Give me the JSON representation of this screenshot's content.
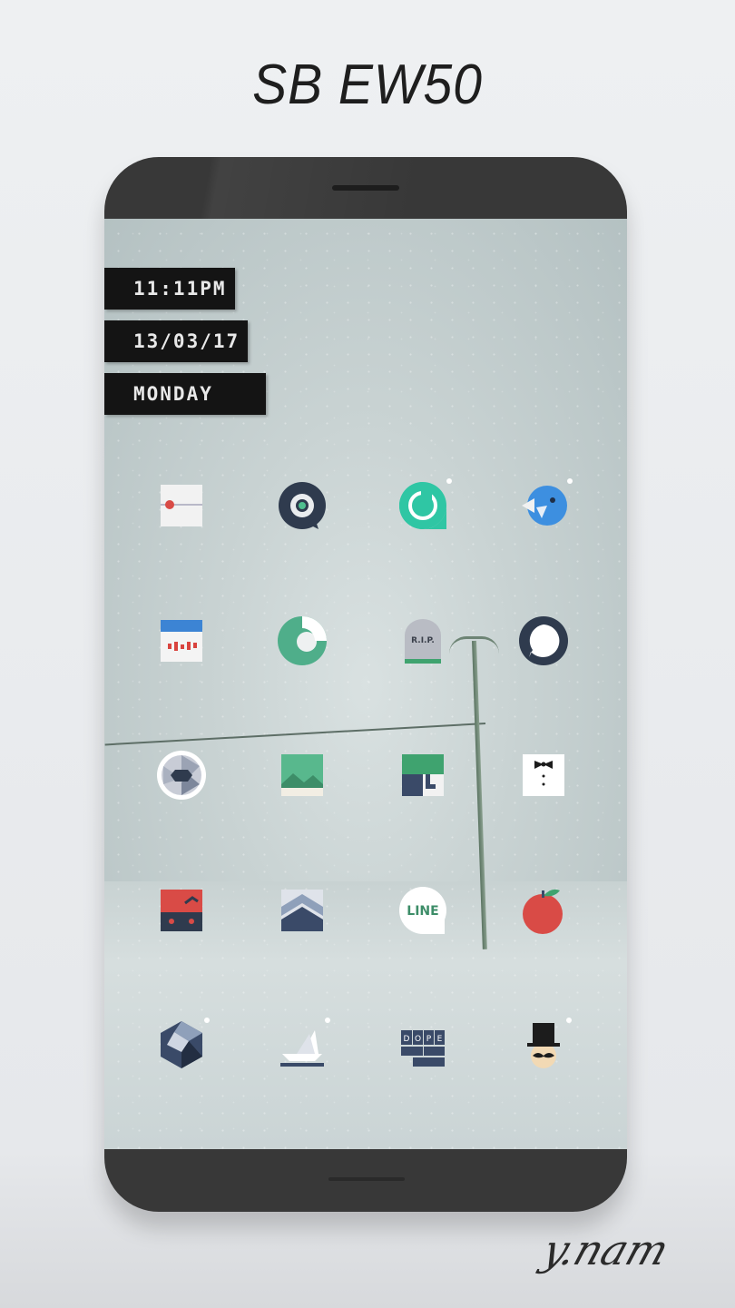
{
  "header": {
    "title": "SB EW50"
  },
  "widgets": {
    "time": "11:11PM",
    "date": "13/03/17",
    "day": "MONDAY"
  },
  "colors": {
    "background": "#eef0f2",
    "phone_body": "#383838",
    "widget_bg": "#141414",
    "widget_text": "#e8e8e8"
  },
  "home_grid": {
    "rows": [
      [
        "slider-app-icon",
        "chat-bubble-app-icon",
        "refresh-bubble-app-icon",
        "blue-bird-app-icon"
      ],
      [
        "calendar-chart-app-icon",
        "green-circle-app-icon",
        "rip-tombstone-app-icon",
        "message-bubble-app-icon"
      ],
      [
        "camera-aperture-app-icon",
        "landscape-photo-app-icon",
        "green-box-app-icon",
        "tuxedo-bowtie-app-icon"
      ],
      [
        "red-robot-app-icon",
        "chevron-stack-app-icon",
        "line-app-icon",
        "red-apple-app-icon"
      ],
      [
        "hexagon-gem-app-icon",
        "paper-boat-app-icon",
        "dope-app-icon",
        "top-hat-mustache-app-icon"
      ]
    ],
    "rip_label": "R.I.P.",
    "line_label": "LINE",
    "dope_letters": [
      "D",
      "O",
      "P",
      "E"
    ]
  },
  "signature": "y.nam"
}
